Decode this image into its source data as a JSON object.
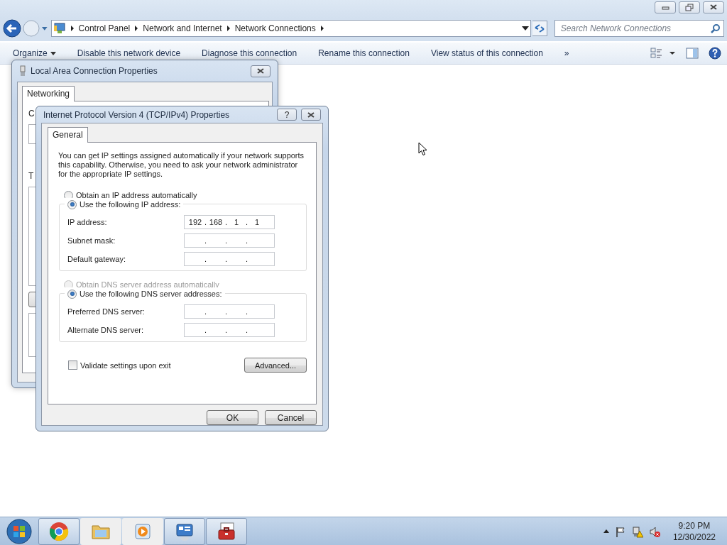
{
  "explorer": {
    "window_controls": [
      {
        "kind": "minimize"
      },
      {
        "kind": "restore"
      },
      {
        "kind": "close"
      }
    ],
    "address_path": [
      "Control Panel",
      "Network and Internet",
      "Network Connections"
    ],
    "search": {
      "placeholder": "Search Network Connections"
    },
    "toolbar": [
      {
        "label": "Organize",
        "kind": "menu"
      },
      {
        "label": "Disable this network device",
        "kind": "command"
      },
      {
        "label": "Diagnose this connection",
        "kind": "command"
      },
      {
        "label": "Rename this connection",
        "kind": "command"
      },
      {
        "label": "View status of this connection",
        "kind": "command"
      },
      {
        "label": "»",
        "kind": "overflow"
      }
    ]
  },
  "lan_dialog": {
    "title": "Local Area Connection Properties",
    "tabs": [
      {
        "label": "Networking",
        "selected": true
      }
    ],
    "labels": [
      "C",
      "T"
    ]
  },
  "ipv4_dialog": {
    "title": "Internet Protocol Version 4 (TCP/IPv4) Properties",
    "help_button": "?",
    "tabs": [
      {
        "label": "General",
        "selected": true
      }
    ],
    "intro": "You can get IP settings assigned automatically if your network supports this capability. Otherwise, you need to ask your network administrator for the appropriate IP settings.",
    "separator": ".",
    "ip_options": [
      {
        "label": "Obtain an IP address automatically",
        "selected": false,
        "disabled": false
      },
      {
        "label": "Use the following IP address:",
        "selected": true,
        "disabled": false
      }
    ],
    "ip_fields": [
      {
        "label": "IP address:",
        "octets": [
          "192",
          "168",
          "1",
          "1"
        ]
      },
      {
        "label": "Subnet mask:"
      },
      {
        "label": "Default gateway:"
      }
    ],
    "dns_options": [
      {
        "label": "Obtain DNS server address automatically",
        "selected": false,
        "disabled": true
      },
      {
        "label": "Use the following DNS server addresses:",
        "selected": true,
        "disabled": false
      }
    ],
    "dns_fields": [
      {
        "label": "Preferred DNS server:"
      },
      {
        "label": "Alternate DNS server:"
      }
    ],
    "validate": {
      "label": "Validate settings upon exit",
      "checked": false
    },
    "buttons": [
      {
        "label": "Advanced...",
        "kind": "advanced"
      },
      {
        "label": "OK",
        "kind": "ok"
      },
      {
        "label": "Cancel",
        "kind": "cancel"
      }
    ]
  },
  "taskbar": {
    "apps": [
      {
        "kind": "chrome",
        "running": true
      },
      {
        "kind": "folder",
        "running": false
      },
      {
        "kind": "media",
        "running": false
      },
      {
        "kind": "control-panel",
        "running": true
      },
      {
        "kind": "toolbox",
        "running": true
      }
    ],
    "tray": [
      {
        "kind": "show-hidden"
      },
      {
        "kind": "flag"
      },
      {
        "kind": "network"
      },
      {
        "kind": "volume-muted"
      }
    ],
    "clock": {
      "time": "9:20 PM",
      "date": "12/30/2022"
    }
  }
}
